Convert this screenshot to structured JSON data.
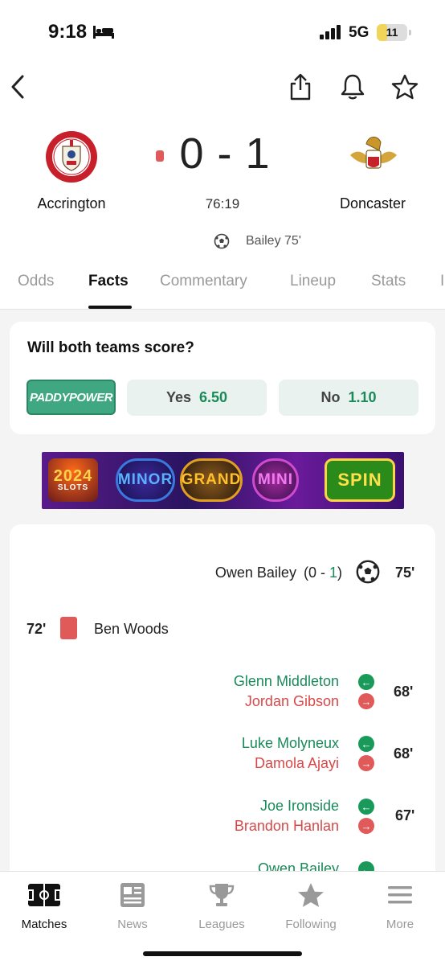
{
  "status_bar": {
    "time": "9:18",
    "network": "5G",
    "battery": "11",
    "battery_level_percent": 11,
    "icons": [
      "bed-icon",
      "signal-icon"
    ]
  },
  "header": {
    "icons": [
      "back-arrow-icon",
      "share-icon",
      "bell-icon",
      "star-icon"
    ]
  },
  "match": {
    "home_team": "Accrington",
    "away_team": "Doncaster",
    "score": "0 - 1",
    "clock": "76:19",
    "goal_summary": "Bailey 75'",
    "live_color": "#e05a5a"
  },
  "tabs": [
    {
      "label": "Odds",
      "active": false
    },
    {
      "label": "Facts",
      "active": true
    },
    {
      "label": "Commentary",
      "active": false
    },
    {
      "label": "Lineup",
      "active": false
    },
    {
      "label": "Stats",
      "active": false
    },
    {
      "label": "I",
      "active": false
    }
  ],
  "betting": {
    "question": "Will both teams score?",
    "bookmaker": "PADDYPOWER",
    "options": [
      {
        "label": "Yes",
        "value": "6.50"
      },
      {
        "label": "No",
        "value": "1.10"
      }
    ]
  },
  "ad": {
    "year": "2024",
    "year_sub": "SLOTS",
    "words": [
      "MINOR",
      "GRAND",
      "MINI"
    ],
    "button": "SPIN"
  },
  "events": {
    "goal": {
      "player": "Owen Bailey",
      "score_open": "(0 - ",
      "score_goal": "1",
      "score_close": ")",
      "minute": "75'"
    },
    "red_card": {
      "minute": "72'",
      "player": "Ben Woods"
    },
    "substitutions": [
      {
        "in": "Glenn Middleton",
        "out": "Jordan Gibson",
        "minute": "68'"
      },
      {
        "in": "Luke Molyneux",
        "out": "Damola Ajayi",
        "minute": "68'"
      },
      {
        "in": "Joe Ironside",
        "out": "Brandon Hanlan",
        "minute": "67'"
      },
      {
        "in": "Owen Bailey"
      }
    ]
  },
  "bottom_nav": [
    {
      "label": "Matches",
      "icon": "pitch-icon",
      "active": true
    },
    {
      "label": "News",
      "icon": "news-icon",
      "active": false
    },
    {
      "label": "Leagues",
      "icon": "trophy-icon",
      "active": false
    },
    {
      "label": "Following",
      "icon": "star-icon",
      "active": false
    },
    {
      "label": "More",
      "icon": "menu-icon",
      "active": false
    }
  ],
  "colors": {
    "accent_green": "#1a8a5a",
    "red": "#e05a5a",
    "odds_bg": "#e9f2ee"
  }
}
